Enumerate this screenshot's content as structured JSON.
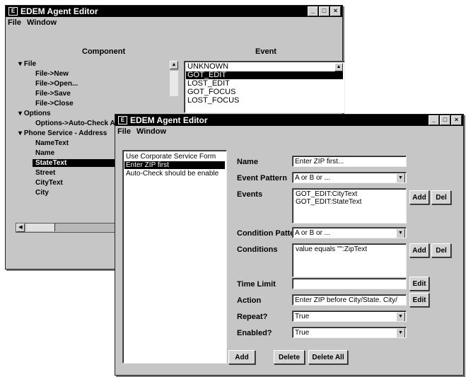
{
  "back_window": {
    "title": "EDEM Agent Editor",
    "menu": [
      "File",
      "Window"
    ],
    "component_header": "Component",
    "event_header": "Event",
    "tree": [
      {
        "label": "File",
        "level": 0,
        "expanded": true
      },
      {
        "label": "File->New",
        "level": 2
      },
      {
        "label": "File->Open...",
        "level": 2
      },
      {
        "label": "File->Save",
        "level": 2
      },
      {
        "label": "File->Close",
        "level": 2
      },
      {
        "label": "Options",
        "level": 0,
        "expanded": true
      },
      {
        "label": "Options->Auto-Check A",
        "level": 2
      },
      {
        "label": "Phone Service - Address",
        "level": 0,
        "expanded": true
      },
      {
        "label": "NameText",
        "level": 2
      },
      {
        "label": "Name",
        "level": 2
      },
      {
        "label": "StateText",
        "level": 2,
        "selected": true
      },
      {
        "label": "Street",
        "level": 2
      },
      {
        "label": "CityText",
        "level": 2
      },
      {
        "label": "City",
        "level": 2
      }
    ],
    "events": [
      "UNKNOWN",
      "GOT_EDIT",
      "LOST_EDIT",
      "GOT_FOCUS",
      "LOST_FOCUS"
    ],
    "selected_event": "GOT_EDIT"
  },
  "front_window": {
    "title": "EDEM Agent Editor",
    "menu": [
      "File",
      "Window"
    ],
    "agents": [
      "Use Corporate Service Form",
      "Enter ZIP first",
      "Auto-Check should be enable"
    ],
    "selected_agent": "Enter ZIP first",
    "labels": {
      "name": "Name",
      "event_pattern": "Event Pattern",
      "events": "Events",
      "condition_pattern": "Condition Pattern",
      "conditions": "Conditions",
      "time_limit": "Time Limit",
      "action": "Action",
      "repeat": "Repeat?",
      "enabled": "Enabled?"
    },
    "values": {
      "name": "Enter ZIP first...",
      "event_pattern": "A or B or ...",
      "events": [
        "GOT_EDIT:CityText",
        "GOT_EDIT:StateText"
      ],
      "condition_pattern": "A or B or ...",
      "conditions": [
        "value equals \"\":ZipText"
      ],
      "time_limit": "",
      "action": "Enter ZIP before City/State. City/",
      "repeat": "True",
      "enabled": "True"
    },
    "buttons": {
      "add": "Add",
      "del": "Del",
      "edit": "Edit",
      "bottom_add": "Add",
      "bottom_delete": "Delete",
      "bottom_delete_all": "Delete All"
    }
  }
}
